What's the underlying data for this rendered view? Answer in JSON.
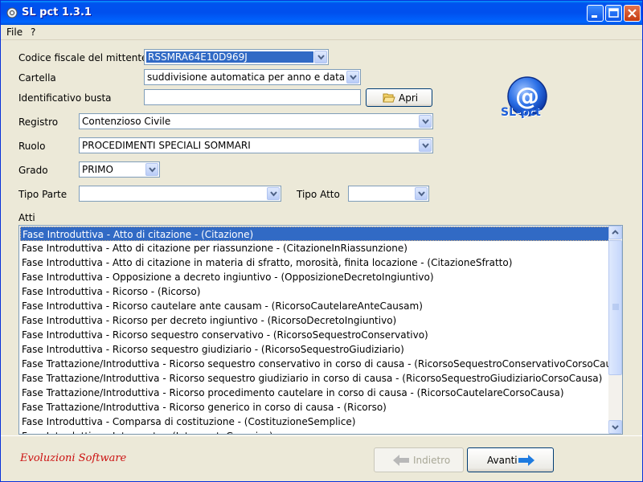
{
  "window": {
    "title": "SL pct 1.3.1"
  },
  "menu": {
    "items": [
      "File",
      "?"
    ]
  },
  "form": {
    "mittente_label": "Codice fiscale del mittente",
    "mittente_value": "RSSMRA64E10D969J",
    "cartella_label": "Cartella",
    "cartella_value": "suddivisione automatica per anno e data",
    "busta_label": "Identificativo busta",
    "busta_value": "",
    "apri_label": "Apri",
    "registro_label": "Registro",
    "registro_value": "Contenzioso Civile",
    "ruolo_label": "Ruolo",
    "ruolo_value": "PROCEDIMENTI SPECIALI SOMMARI",
    "grado_label": "Grado",
    "grado_value": "PRIMO",
    "tipo_parte_label": "Tipo Parte",
    "tipo_parte_value": "",
    "tipo_atto_label": "Tipo Atto",
    "tipo_atto_value": ""
  },
  "logo": {
    "symbol": "@",
    "text": "SL-pct",
    "color": "#1e5fd8"
  },
  "atti": {
    "label": "Atti",
    "selected_index": 0,
    "items": [
      "Fase Introduttiva - Atto di citazione - (Citazione)",
      "Fase Introduttiva - Atto di citazione per riassunzione - (CitazioneInRiassunzione)",
      "Fase Introduttiva - Atto di citazione in materia di sfratto, morosità, finita locazione - (CitazioneSfratto)",
      "Fase Introduttiva - Opposizione a decreto ingiuntivo - (OpposizioneDecretoIngiuntivo)",
      "Fase Introduttiva - Ricorso - (Ricorso)",
      "Fase Introduttiva - Ricorso cautelare ante causam - (RicorsoCautelareAnteCausam)",
      "Fase Introduttiva - Ricorso per decreto ingiuntivo - (RicorsoDecretoIngiuntivo)",
      "Fase Introduttiva - Ricorso sequestro conservativo - (RicorsoSequestroConservativo)",
      "Fase Introduttiva - Ricorso sequestro giudiziario - (RicorsoSequestroGiudiziario)",
      "Fase Trattazione/Introduttiva - Ricorso sequestro conservativo in corso di causa - (RicorsoSequestroConservativoCorsoCausa)",
      "Fase Trattazione/Introduttiva - Ricorso sequestro giudiziario in corso di causa - (RicorsoSequestroGiudiziarioCorsoCausa)",
      "Fase Trattazione/Introduttiva - Ricorso procedimento cautelare in corso di causa - (RicorsoCautelareCorsoCausa)",
      "Fase Trattazione/Introduttiva - Ricorso generico in corso di causa - (Ricorso)",
      "Fase Introduttiva - Comparsa di costituzione - (CostituzioneSemplice)",
      "Fase Introduttiva - Intervento - (InterventoGenerico)"
    ]
  },
  "footer": {
    "brand": "Evoluzioni Software",
    "indietro_label": "Indietro",
    "avanti_label": "Avanti",
    "indietro_enabled": false
  },
  "colors": {
    "selection": "#316ac5",
    "titlebar": "#0053ee",
    "brand": "#cc1010",
    "arrow": "#1e7be0"
  }
}
